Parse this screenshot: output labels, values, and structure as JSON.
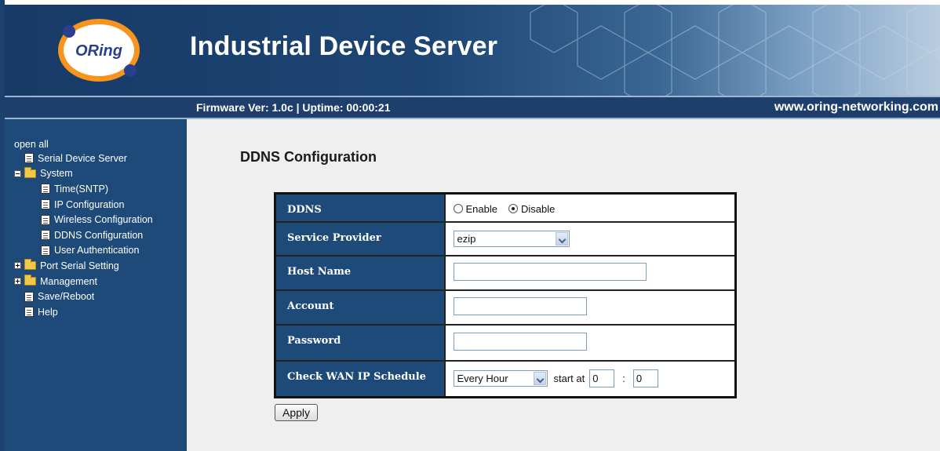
{
  "header": {
    "logo_text": "ORing",
    "title": "Industrial Device Server",
    "firmware_status": "Firmware Ver: 1.0c | Uptime: 00:00:21",
    "website": "www.oring-networking.com"
  },
  "sidebar": {
    "open_all": "open all",
    "items": [
      {
        "label": "Serial Device Server",
        "icon": "document-icon"
      },
      {
        "label": "System",
        "icon": "folder-open-icon",
        "expanded": true
      },
      {
        "label": "Time(SNTP)",
        "icon": "document-icon"
      },
      {
        "label": "IP Configuration",
        "icon": "document-icon"
      },
      {
        "label": "Wireless Configuration",
        "icon": "document-icon"
      },
      {
        "label": "DDNS Configuration",
        "icon": "document-icon"
      },
      {
        "label": "User Authentication",
        "icon": "document-icon"
      },
      {
        "label": "Port Serial Setting",
        "icon": "folder-icon",
        "expanded": false
      },
      {
        "label": "Management",
        "icon": "folder-icon",
        "expanded": false
      },
      {
        "label": "Save/Reboot",
        "icon": "document-icon"
      },
      {
        "label": "Help",
        "icon": "document-icon"
      }
    ]
  },
  "main": {
    "title": "DDNS Configuration",
    "rows": {
      "ddns": {
        "label": "DDNS",
        "enable": "Enable",
        "disable": "Disable",
        "selected": "Disable"
      },
      "provider": {
        "label": "Service Provider",
        "value": "ezip"
      },
      "host": {
        "label": "Host Name",
        "value": ""
      },
      "account": {
        "label": "Account",
        "value": ""
      },
      "password": {
        "label": "Password",
        "value": ""
      },
      "schedule": {
        "label": "Check WAN IP Schedule",
        "value": "Every Hour",
        "start_at": "start at",
        "hour": "0",
        "separator": ":",
        "minute": "0"
      }
    },
    "apply_label": "Apply"
  },
  "colors": {
    "header_dark": "#173a66",
    "sidebar": "#1e4a79",
    "content_bg": "#efefef",
    "label_cell": "#1e4a79"
  }
}
